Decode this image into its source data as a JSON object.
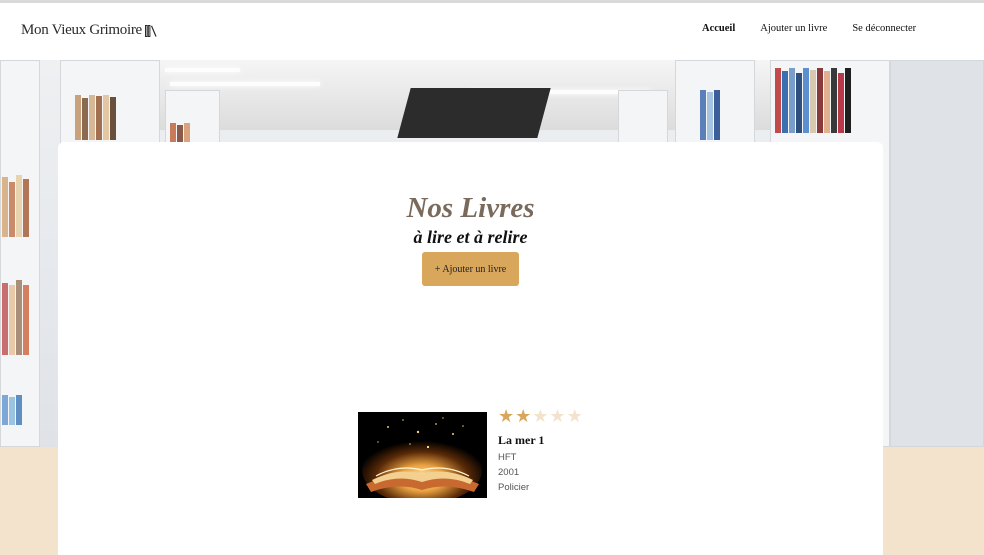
{
  "header": {
    "logo_text": "Mon Vieux Grimoire",
    "nav": [
      {
        "label": "Accueil",
        "active": true
      },
      {
        "label": "Ajouter un livre",
        "active": false
      },
      {
        "label": "Se déconnecter",
        "active": false
      }
    ]
  },
  "main": {
    "title": "Nos Livres",
    "subtitle": "à lire et à relire",
    "add_button_label": "+ Ajouter un livre"
  },
  "books": [
    {
      "title": "La mer 1",
      "author": "HFT",
      "year": "2001",
      "genre": "Policier",
      "rating": 2,
      "max_rating": 5
    }
  ],
  "colors": {
    "accent": "#d8a75b",
    "title": "#7a6a5c",
    "background": "#f3e3cc",
    "star_off": "#f3e3cc"
  }
}
